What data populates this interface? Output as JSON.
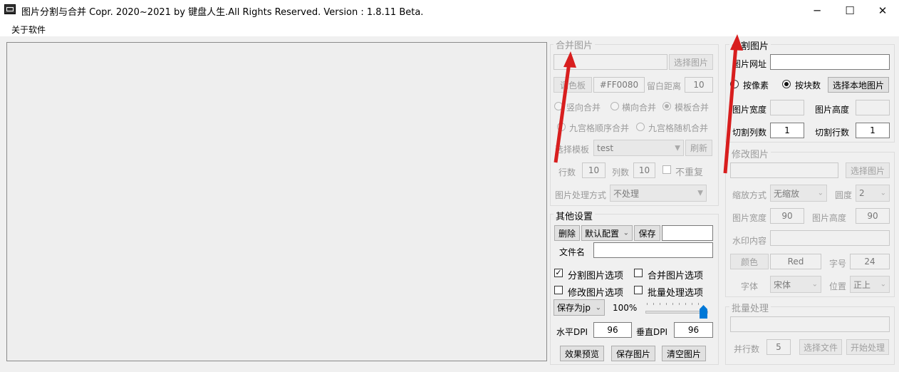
{
  "window": {
    "title": "图片分割与合并    Copr. 2020~2021 by 键盘人生.All Rights Reserved.  Version : 1.8.11 Beta.",
    "minimize": "─",
    "maximize": "☐",
    "close": "✕"
  },
  "menu": {
    "about": "关于软件"
  },
  "merge": {
    "legend": "合并图片",
    "select_btn": "选择图片",
    "palette_btn": "调色板",
    "color_value": "#FF0080",
    "margin_label": "留白距离",
    "margin_value": "10",
    "radio_vertical": "竖向合并",
    "radio_horizontal": "横向合并",
    "radio_template": "模板合并",
    "radio_grid_seq": "九宫格顺序合并",
    "radio_grid_rand": "九宫格随机合并",
    "template_label": "选择模板",
    "template_value": "test",
    "refresh_btn": "刷新",
    "rows_label": "行数",
    "rows_value": "10",
    "cols_label": "列数",
    "cols_value": "10",
    "no_repeat": "不重复",
    "process_label": "图片处理方式",
    "process_value": "不处理"
  },
  "other": {
    "legend": "其他设置",
    "delete_btn": "删除",
    "config_value": "默认配置",
    "save_btn": "保存",
    "filename_label": "文件名",
    "chk_split": "分割图片选项",
    "chk_merge": "合并图片选项",
    "chk_modify": "修改图片选项",
    "chk_batch": "批量处理选项",
    "saveas_value": "保存为jp",
    "quality": "100%",
    "hdpi_label": "水平DPI",
    "hdpi_value": "96",
    "vdpi_label": "垂直DPI",
    "vdpi_value": "96",
    "preview_btn": "效果预览",
    "saveimg_btn": "保存图片",
    "clear_btn": "清空图片"
  },
  "split": {
    "legend": "分割图片",
    "url_label": "图片网址",
    "radio_pixel": "按像素",
    "radio_block": "按块数",
    "select_local_btn": "选择本地图片",
    "width_label": "图片宽度",
    "height_label": "图片高度",
    "cols_label": "切割列数",
    "cols_value": "1",
    "rows_label": "切割行数",
    "rows_value": "1"
  },
  "modify": {
    "legend": "修改图片",
    "select_btn": "选择图片",
    "scale_label": "缩放方式",
    "scale_value": "无缩放",
    "round_label": "圆度",
    "round_value": "2",
    "width_label": "图片宽度",
    "width_value": "90",
    "height_label": "图片高度",
    "height_value": "90",
    "watermark_label": "水印内容",
    "color_btn": "颜色",
    "color_value": "Red",
    "size_label": "字号",
    "size_value": "24",
    "font_label": "字体",
    "font_value": "宋体",
    "pos_label": "位置",
    "pos_value": "正上"
  },
  "batch": {
    "legend": "批量处理",
    "threads_label": "并行数",
    "threads_value": "5",
    "select_btn": "选择文件",
    "start_btn": "开始处理"
  },
  "colors": {
    "accent": "#0078d7",
    "annotation": "#d81e1e"
  }
}
